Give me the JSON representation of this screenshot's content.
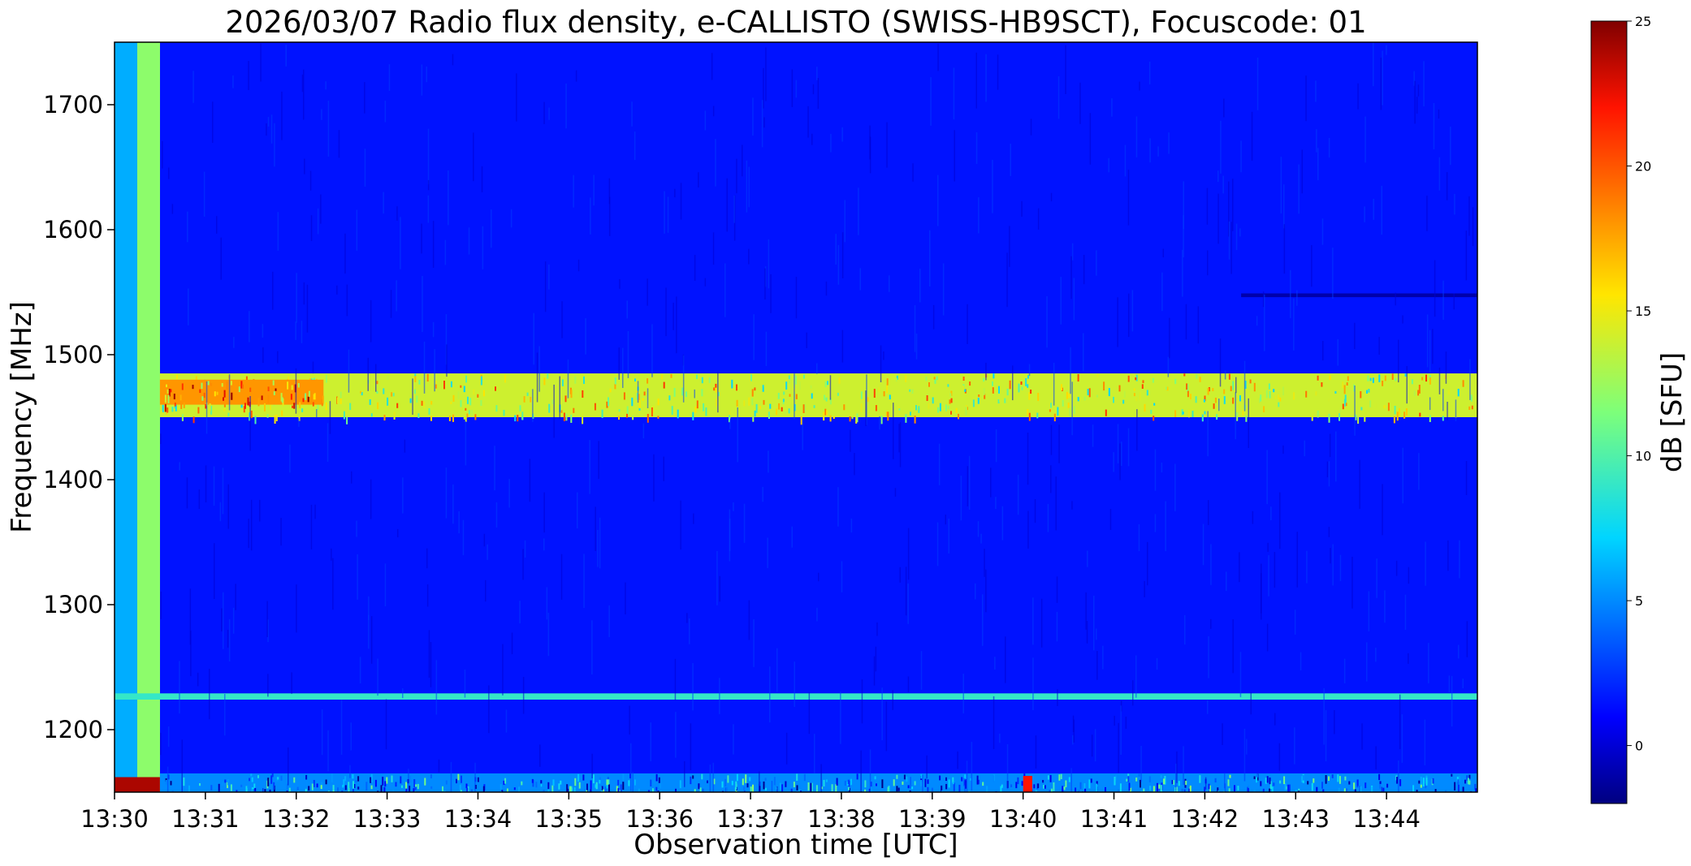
{
  "chart_data": {
    "type": "heatmap",
    "title": "2026/03/07  Radio flux density, e-CALLISTO (SWISS-HB9SCT), Focuscode: 01",
    "xlabel": "Observation time [UTC]",
    "ylabel": "Frequency [MHz]",
    "x_tick_labels": [
      "13:30",
      "13:31",
      "13:32",
      "13:33",
      "13:34",
      "13:35",
      "13:36",
      "13:37",
      "13:38",
      "13:39",
      "13:40",
      "13:41",
      "13:42",
      "13:43",
      "13:44"
    ],
    "x_range_minutes": [
      0,
      15
    ],
    "y_ticks": [
      1200,
      1300,
      1400,
      1500,
      1600,
      1700
    ],
    "y_tick_labels": [
      "1200",
      "1300",
      "1400",
      "1500",
      "1600",
      "1700"
    ],
    "ylim": [
      1150,
      1750
    ],
    "grid": false,
    "colorbar": {
      "label": "dB [SFU]",
      "colormap": "jet",
      "range": [
        -2,
        25
      ],
      "ticks": [
        0,
        5,
        10,
        15,
        20,
        25
      ],
      "tick_labels": [
        "0",
        "5",
        "10",
        "15",
        "20",
        "25"
      ],
      "position": "right"
    },
    "background_level_db": 1.5,
    "features": [
      {
        "description": "calibration column, frequency-structured",
        "t_start_min": 0.0,
        "t_end_min": 0.25,
        "freq_low": 1150,
        "freq_high": 1750,
        "level_db": 6
      },
      {
        "description": "calibration column, bright",
        "t_start_min": 0.25,
        "t_end_min": 0.5,
        "freq_low": 1150,
        "freq_high": 1750,
        "level_db": 12
      },
      {
        "description": "broadband interference band",
        "t_start_min": 0.5,
        "t_end_min": 15,
        "freq_low": 1450,
        "freq_high": 1485,
        "level_db": 14
      },
      {
        "description": "strong interference near start",
        "t_start_min": 0.5,
        "t_end_min": 2.3,
        "freq_low": 1460,
        "freq_high": 1480,
        "level_db": 18
      },
      {
        "description": "narrowband interference line",
        "t_start_min": 0.0,
        "t_end_min": 15,
        "freq_low": 1224,
        "freq_high": 1229,
        "level_db": 9
      },
      {
        "description": "low-frequency interference rows",
        "t_start_min": 0.5,
        "t_end_min": 15,
        "freq_low": 1150,
        "freq_high": 1165,
        "level_db": 5
      },
      {
        "description": "short burst",
        "t_start_min": 10.0,
        "t_end_min": 10.1,
        "freq_low": 1150,
        "freq_high": 1163,
        "level_db": 22
      },
      {
        "description": "saturated calibration segment",
        "t_start_min": 0.0,
        "t_end_min": 0.5,
        "freq_low": 1150,
        "freq_high": 1162,
        "level_db": 24
      },
      {
        "description": "dark absorption line",
        "t_start_min": 12.4,
        "t_end_min": 15,
        "freq_low": 1546,
        "freq_high": 1549,
        "level_db": -1
      }
    ]
  }
}
